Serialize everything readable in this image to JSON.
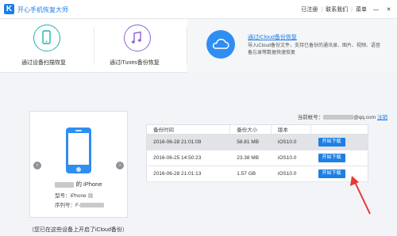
{
  "app": {
    "logo_letter": "K",
    "title": "开心手机恢复大师"
  },
  "top_links": {
    "register": "已注册",
    "contact": "联系我们",
    "menu": "菜单",
    "sep": "|"
  },
  "window_controls": {
    "minimize": "—",
    "close": "✕"
  },
  "modes": [
    {
      "label": "通过设备扫描恢复",
      "icon": "phone-icon",
      "color": "#19b6b0"
    },
    {
      "label": "通过iTunes备份恢复",
      "icon": "music-icon",
      "color": "#8a63d6"
    },
    {
      "label": "通过iCloud备份恢复",
      "icon": "cloud-icon",
      "color": "#2f8ef2",
      "description": "导入iCloud备份文件，支持已备份的通讯录、图片、视频、语音备忘录等数据快速恢复"
    }
  ],
  "account": {
    "label": "当前帐号：",
    "email_suffix": "@qq.com",
    "logout": "注销"
  },
  "device": {
    "name_suffix": "的 iPhone",
    "model_label": "型号：",
    "model_value": "iPhone ",
    "serial_label": "序列号：",
    "serial_value": "F-",
    "prev": "‹",
    "next": "›"
  },
  "bottom_note": "（您已在这些设备上开启了iCloud备份）",
  "table": {
    "headers": [
      "备份时间",
      "备份大小",
      "版本",
      ""
    ],
    "rows": [
      {
        "time": "2016-06-28 21:01:09",
        "size": "58.81 MB",
        "version": "iOS10.0",
        "action": "开始下载",
        "selected": true
      },
      {
        "time": "2016-06-25 14:50:23",
        "size": "23.38 MB",
        "version": "iOS10.0",
        "action": "开始下载",
        "selected": false
      },
      {
        "time": "2016-06-28 21:01:13",
        "size": "1.57 GB",
        "version": "iOS10.0",
        "action": "开始下载",
        "selected": false
      }
    ]
  },
  "colors": {
    "accent": "#1d7fe3",
    "annotation": "#e53935"
  }
}
